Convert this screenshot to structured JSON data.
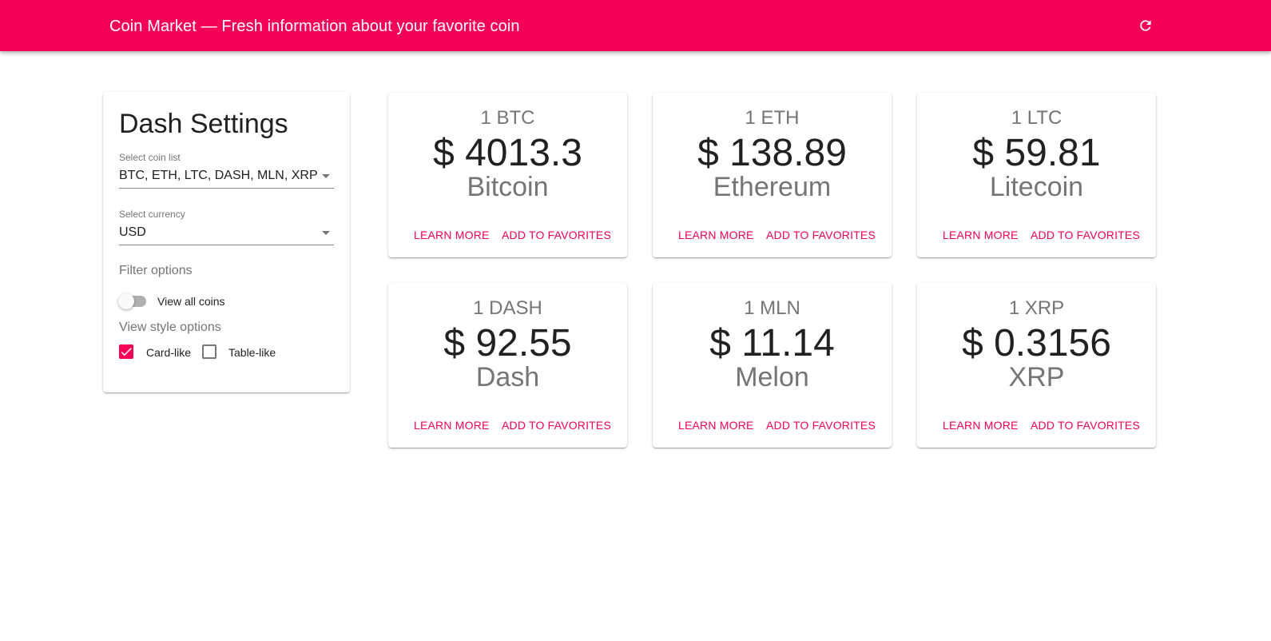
{
  "app": {
    "title": "Coin Market — Fresh information about your favorite coin",
    "refresh_icon": "refresh-icon",
    "accent_color": "#f50057"
  },
  "settings": {
    "title": "Dash Settings",
    "coin_list": {
      "label": "Select coin list",
      "value": "BTC, ETH, LTC, DASH, MLN, XRP"
    },
    "currency": {
      "label": "Select currency",
      "value": "USD"
    },
    "filter": {
      "label": "Filter options",
      "toggle_label": "View all coins",
      "toggle_on": false
    },
    "view_style": {
      "label": "View style options",
      "options": [
        {
          "label": "Card-like",
          "checked": true
        },
        {
          "label": "Table-like",
          "checked": false
        }
      ]
    }
  },
  "cards": [
    {
      "amount": "1 BTC",
      "price": "$ 4013.3",
      "name": "Bitcoin",
      "learn": "Learn more",
      "favorite": "Add to favorites"
    },
    {
      "amount": "1 ETH",
      "price": "$ 138.89",
      "name": "Ethereum",
      "learn": "Learn more",
      "favorite": "Add to favorites"
    },
    {
      "amount": "1 LTC",
      "price": "$ 59.81",
      "name": "Litecoin",
      "learn": "Learn more",
      "favorite": "Add to favorites"
    },
    {
      "amount": "1 DASH",
      "price": "$ 92.55",
      "name": "Dash",
      "learn": "Learn more",
      "favorite": "Add to favorites"
    },
    {
      "amount": "1 MLN",
      "price": "$ 11.14",
      "name": "Melon",
      "learn": "Learn more",
      "favorite": "Add to favorites"
    },
    {
      "amount": "1 XRP",
      "price": "$ 0.3156",
      "name": "XRP",
      "learn": "Learn more",
      "favorite": "Add to favorites"
    }
  ]
}
